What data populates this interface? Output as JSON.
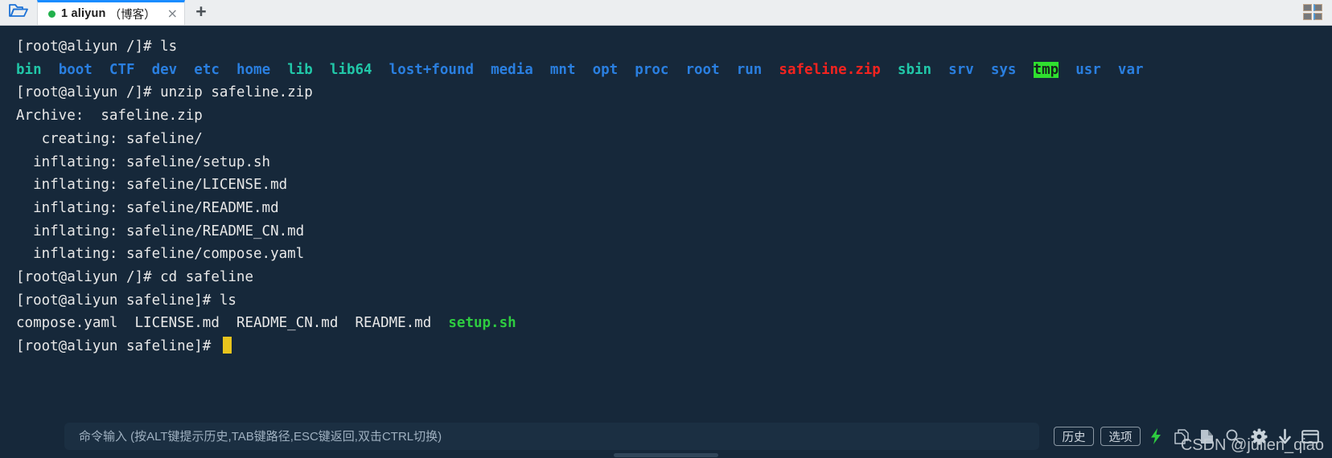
{
  "window": {
    "grid_icon": "grid-layout-icon"
  },
  "tabbar": {
    "folder_icon": "folder-open-icon",
    "new_tab_label": "+",
    "close_label": "×",
    "tabs": [
      {
        "index_label": "1 aliyun",
        "suffix": "（博客）",
        "status": "connected"
      }
    ]
  },
  "terminal": {
    "lines": [
      {
        "segs": [
          {
            "t": "[root@aliyun /]# ls",
            "c": "c-white"
          }
        ]
      },
      {
        "segs": [
          {
            "t": "bin",
            "c": "c-teal"
          },
          {
            "t": "  ",
            "c": "c-white"
          },
          {
            "t": "boot",
            "c": "c-blue"
          },
          {
            "t": "  ",
            "c": "c-white"
          },
          {
            "t": "CTF",
            "c": "c-blue"
          },
          {
            "t": "  ",
            "c": "c-white"
          },
          {
            "t": "dev",
            "c": "c-blue"
          },
          {
            "t": "  ",
            "c": "c-white"
          },
          {
            "t": "etc",
            "c": "c-blue"
          },
          {
            "t": "  ",
            "c": "c-white"
          },
          {
            "t": "home",
            "c": "c-blue"
          },
          {
            "t": "  ",
            "c": "c-white"
          },
          {
            "t": "lib",
            "c": "c-teal"
          },
          {
            "t": "  ",
            "c": "c-white"
          },
          {
            "t": "lib64",
            "c": "c-teal"
          },
          {
            "t": "  ",
            "c": "c-white"
          },
          {
            "t": "lost+found",
            "c": "c-blue"
          },
          {
            "t": "  ",
            "c": "c-white"
          },
          {
            "t": "media",
            "c": "c-blue"
          },
          {
            "t": "  ",
            "c": "c-white"
          },
          {
            "t": "mnt",
            "c": "c-blue"
          },
          {
            "t": "  ",
            "c": "c-white"
          },
          {
            "t": "opt",
            "c": "c-blue"
          },
          {
            "t": "  ",
            "c": "c-white"
          },
          {
            "t": "proc",
            "c": "c-blue"
          },
          {
            "t": "  ",
            "c": "c-white"
          },
          {
            "t": "root",
            "c": "c-blue"
          },
          {
            "t": "  ",
            "c": "c-white"
          },
          {
            "t": "run",
            "c": "c-blue"
          },
          {
            "t": "  ",
            "c": "c-white"
          },
          {
            "t": "safeline.zip",
            "c": "c-red"
          },
          {
            "t": "  ",
            "c": "c-white"
          },
          {
            "t": "sbin",
            "c": "c-teal"
          },
          {
            "t": "  ",
            "c": "c-white"
          },
          {
            "t": "srv",
            "c": "c-blue"
          },
          {
            "t": "  ",
            "c": "c-white"
          },
          {
            "t": "sys",
            "c": "c-blue"
          },
          {
            "t": "  ",
            "c": "c-white"
          },
          {
            "t": "tmp",
            "c": "c-tmp"
          },
          {
            "t": "  ",
            "c": "c-white"
          },
          {
            "t": "usr",
            "c": "c-blue"
          },
          {
            "t": "  ",
            "c": "c-white"
          },
          {
            "t": "var",
            "c": "c-blue"
          }
        ]
      },
      {
        "segs": [
          {
            "t": "[root@aliyun /]# unzip safeline.zip",
            "c": "c-white"
          }
        ]
      },
      {
        "segs": [
          {
            "t": "Archive:  safeline.zip",
            "c": "c-white"
          }
        ]
      },
      {
        "segs": [
          {
            "t": "   creating: safeline/",
            "c": "c-white"
          }
        ]
      },
      {
        "segs": [
          {
            "t": "  inflating: safeline/setup.sh",
            "c": "c-white"
          }
        ]
      },
      {
        "segs": [
          {
            "t": "  inflating: safeline/LICENSE.md",
            "c": "c-white"
          }
        ]
      },
      {
        "segs": [
          {
            "t": "  inflating: safeline/README.md",
            "c": "c-white"
          }
        ]
      },
      {
        "segs": [
          {
            "t": "  inflating: safeline/README_CN.md",
            "c": "c-white"
          }
        ]
      },
      {
        "segs": [
          {
            "t": "  inflating: safeline/compose.yaml",
            "c": "c-white"
          }
        ]
      },
      {
        "segs": [
          {
            "t": "[root@aliyun /]# cd safeline",
            "c": "c-white"
          }
        ]
      },
      {
        "segs": [
          {
            "t": "[root@aliyun safeline]# ls",
            "c": "c-white"
          }
        ]
      },
      {
        "segs": [
          {
            "t": "compose.yaml",
            "c": "c-white"
          },
          {
            "t": "  ",
            "c": "c-white"
          },
          {
            "t": "LICENSE.md",
            "c": "c-white"
          },
          {
            "t": "  ",
            "c": "c-white"
          },
          {
            "t": "README_CN.md",
            "c": "c-white"
          },
          {
            "t": "  ",
            "c": "c-white"
          },
          {
            "t": "README.md",
            "c": "c-white"
          },
          {
            "t": "  ",
            "c": "c-white"
          },
          {
            "t": "setup.sh",
            "c": "c-green"
          }
        ]
      },
      {
        "segs": [
          {
            "t": "[root@aliyun safeline]# ",
            "c": "c-white"
          }
        ],
        "cursor": true
      }
    ]
  },
  "bottombar": {
    "input_placeholder": "命令输入 (按ALT键提示历史,TAB键路径,ESC键返回,双击CTRL切换)",
    "input_value": "",
    "history_label": "历史",
    "options_label": "选项",
    "icons": [
      "lightning-bolt-icon",
      "copy-icon",
      "paste-icon",
      "search-icon",
      "gear-icon",
      "download-icon",
      "window-icon"
    ]
  },
  "watermark": {
    "text": "CSDN @julien_qiao"
  },
  "colors": {
    "terminal_bg": "#16283a",
    "tab_accent": "#1a8cff",
    "dir_blue": "#2a7fe0",
    "symlink_teal": "#21c7a8",
    "archive_red": "#f4231f",
    "exec_green": "#2ecc40",
    "tmp_bg_green": "#2fe02f",
    "cursor_yellow": "#e8c41d",
    "bolt_green": "#2ecc40"
  }
}
